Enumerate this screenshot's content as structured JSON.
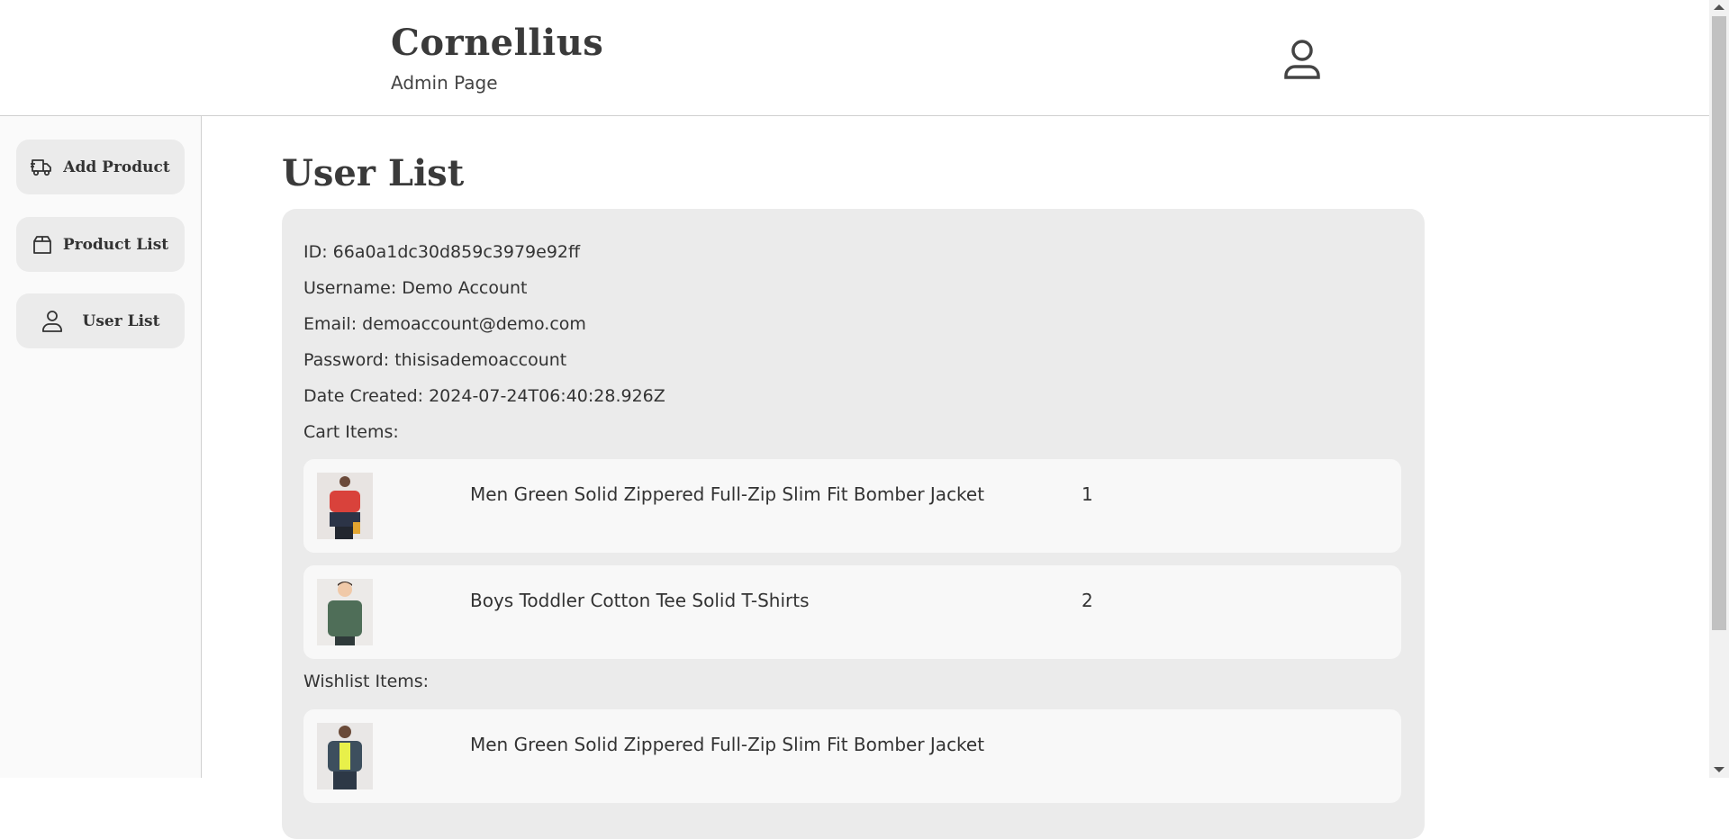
{
  "header": {
    "brand_title": "Cornellius",
    "brand_subtitle": "Admin Page",
    "account_icon": "user-icon"
  },
  "sidebar": {
    "items": [
      {
        "label": "Add Product",
        "icon": "truck-icon"
      },
      {
        "label": "Product List",
        "icon": "box-icon"
      },
      {
        "label": "User List",
        "icon": "user-icon"
      }
    ]
  },
  "main": {
    "title": "User List",
    "user": {
      "id": "ID: 66a0a1dc30d859c3979e92ff",
      "username": "Username: Demo Account",
      "email": "Email: demoaccount@demo.com",
      "password": "Password: thisisademoaccount",
      "date_created": "Date Created: 2024-07-24T06:40:28.926Z",
      "cart_label": "Cart Items:",
      "cart_items": [
        {
          "name": "Men Green Solid Zippered Full-Zip Slim Fit Bomber Jacket",
          "qty": "1"
        },
        {
          "name": "Boys Toddler Cotton Tee Solid T-Shirts",
          "qty": "2"
        }
      ],
      "wishlist_label": "Wishlist Items:",
      "wishlist_items": [
        {
          "name": "Men Green Solid Zippered Full-Zip Slim Fit Bomber Jacket"
        }
      ]
    }
  },
  "colors": {
    "card_bg": "#ebebeb",
    "row_bg": "#f8f8f8",
    "sidebar_bg": "#fafafa",
    "text": "#333333"
  }
}
